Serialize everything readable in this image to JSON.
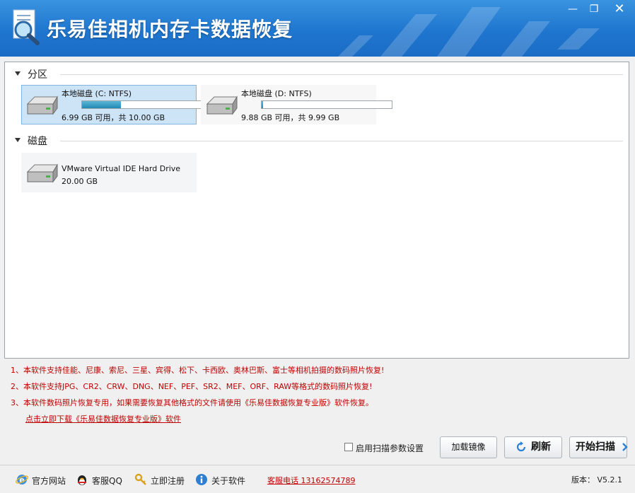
{
  "window": {
    "title": "乐易佳相机内存卡数据恢复",
    "controls": {
      "minimize": "—",
      "maximize": "❐",
      "close": "✕"
    }
  },
  "sections": {
    "partitions": {
      "label": "分区"
    },
    "disks": {
      "label": "磁盘"
    }
  },
  "partitions": [
    {
      "name": "本地磁盘 (C: NTFS)",
      "summary": "6.99 GB 可用，共 10.00 GB",
      "used_fraction": 0.301,
      "selected": true
    },
    {
      "name": "本地磁盘 (D: NTFS)",
      "summary": "9.88 GB 可用，共 9.99 GB",
      "used_fraction": 0.011,
      "selected": false
    }
  ],
  "disks": [
    {
      "name": "VMware Virtual IDE Hard Drive",
      "summary": "20.00 GB"
    }
  ],
  "notes": [
    "1、本软件支持佳能、尼康、索尼、三星、宾得、松下、卡西欧、奥林巴斯、富士等相机拍摄的数码照片恢复!",
    "2、本软件支持JPG、CR2、CRW、DNG、NEF、PEF、SR2、MEF、ORF、RAW等格式的数码照片恢复!",
    "3、本软件数码照片恢复专用，如果需要恢复其他格式的文件请使用《乐易佳数据恢复专业版》软件恢复。"
  ],
  "download_link": "点击立即下载《乐易佳数据恢复专业版》软件",
  "controls": {
    "scan_settings_label": "启用扫描参数设置",
    "load_image_label": "加载镜像",
    "refresh_label": "刷新",
    "start_scan_label": "开始扫描"
  },
  "footer": {
    "website": "官方网站",
    "qq": "客服QQ",
    "register": "立即注册",
    "about": "关于软件",
    "hotline": "客服电话 13162574789",
    "version": "版本： V5.2.1"
  },
  "colors": {
    "titlebar": "#1f76cf",
    "selection": "#cde4f7",
    "note_red": "#c00000",
    "bar_fill": "#2288b4"
  },
  "icons": {
    "app": "magnifier-document-icon",
    "drive": "hard-drive-icon",
    "website": "ie-globe-icon",
    "qq": "penguin-icon",
    "register": "key-icon",
    "about": "info-icon",
    "refresh": "refresh-icon",
    "start": "chevron-right-icon"
  }
}
